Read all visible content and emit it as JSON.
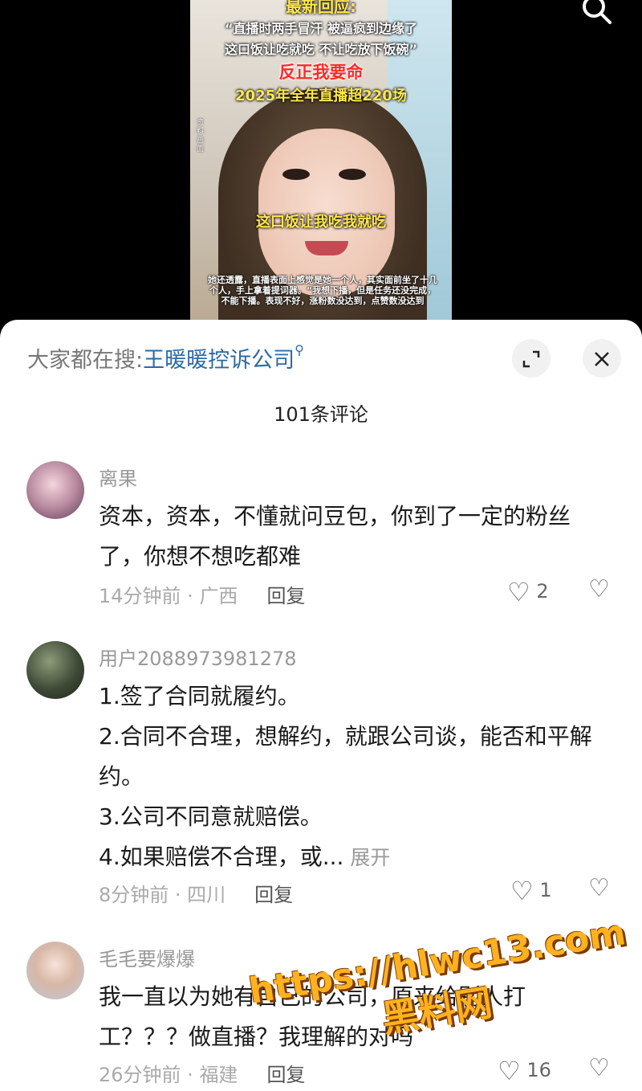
{
  "video": {
    "headline": "最新回应:",
    "quote_line1": "“直播时两手冒汗 被逼疯到边缘了",
    "quote_line2": "这口饭让吃就吃 不让吃放下饭碗”",
    "red_line": "反正我要命",
    "stat_line": "2025年全年直播超220场",
    "mid_caption": "这口饭让我吃我就吃",
    "side_note": "资料画面",
    "subtitle": "她还透露，直播表面上感觉是她一个人，其实面前坐了十几个人，手上拿着提词器。“我想下播，但是任务还没完成，不能下播。表现不好，涨粉数没达到，点赞数没达到"
  },
  "sheet": {
    "hot_search_label": "大家都在搜:",
    "hot_search_query": "王暖暖控诉公司",
    "comment_count": "101条评论"
  },
  "comments": [
    {
      "user": "离果",
      "text": "资本，资本，不懂就问豆包，你到了一定的粉丝了，你想不想吃都难",
      "time": "14分钟前",
      "location": "广西",
      "reply": "回复",
      "likes": "2"
    },
    {
      "user": "用户2088973981278",
      "lines": [
        "1.签了合同就履约。",
        "2.合同不合理，想解约，就跟公司谈，能否和平解约。",
        "3.公司不同意就赔偿。",
        "4.如果赔偿不合理，或..."
      ],
      "expand": "展开",
      "time": "8分钟前",
      "location": "四川",
      "reply": "回复",
      "likes": "1"
    },
    {
      "user": "毛毛要爆爆",
      "text": "我一直以为她有自己的公司，原来给别人打工？？？做直播？我理解的对吗",
      "time": "26分钟前",
      "location": "福建",
      "reply": "回复",
      "likes": "16"
    }
  ],
  "watermark": {
    "line1": "https://hlwc13.com",
    "line2": "黑料网"
  },
  "icons": [
    "search-icon",
    "expand-icon",
    "close-icon",
    "heart-icon",
    "dislike-icon"
  ]
}
